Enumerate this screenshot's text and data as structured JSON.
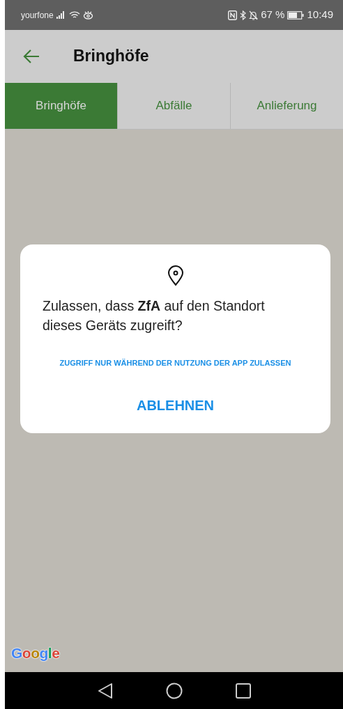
{
  "status_bar": {
    "carrier": "yourfone",
    "battery_text": "67 %",
    "time": "10:49"
  },
  "app_bar": {
    "title": "Bringhöfe"
  },
  "tabs": [
    {
      "label": "Bringhöfe",
      "selected": true
    },
    {
      "label": "Abfälle",
      "selected": false
    },
    {
      "label": "Anlieferung",
      "selected": false
    }
  ],
  "map": {
    "logo": "Google"
  },
  "dialog": {
    "message": "Zulassen, dass **ZfA** auf den Standort dieses Geräts zugreift?",
    "buttons": [
      "ZUGRIFF NUR WÄHREND DER NUTZUNG DER APP ZULASSEN",
      "ABLEHNEN"
    ]
  }
}
